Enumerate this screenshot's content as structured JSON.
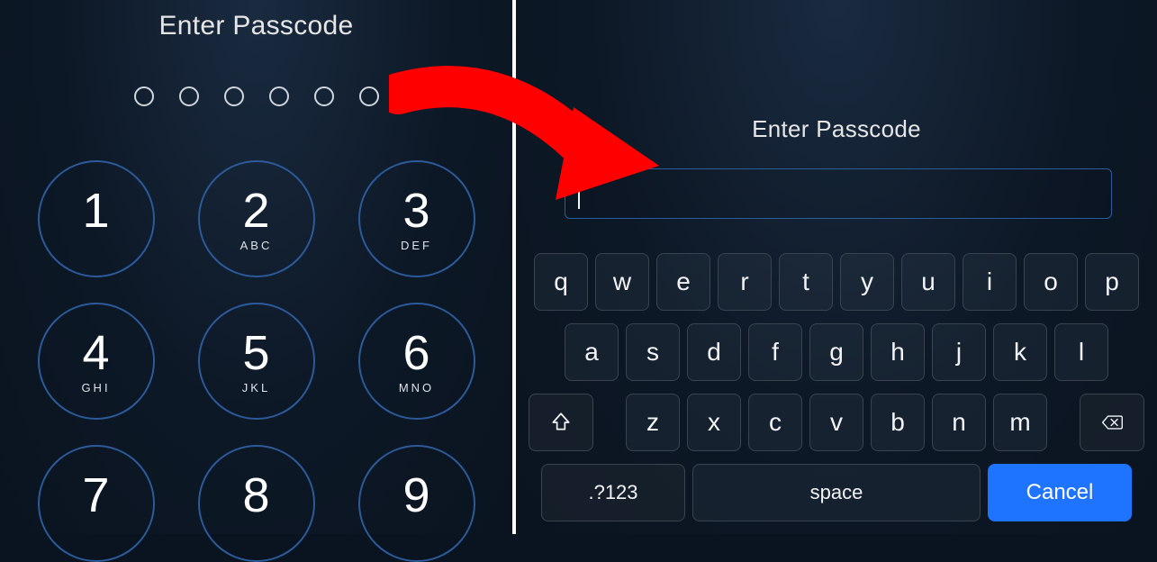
{
  "left": {
    "title": "Enter Passcode",
    "dots_count": 6,
    "keys": [
      {
        "num": "1",
        "sub": ""
      },
      {
        "num": "2",
        "sub": "ABC"
      },
      {
        "num": "3",
        "sub": "DEF"
      },
      {
        "num": "4",
        "sub": "GHI"
      },
      {
        "num": "5",
        "sub": "JKL"
      },
      {
        "num": "6",
        "sub": "MNO"
      },
      {
        "num": "7",
        "sub": ""
      },
      {
        "num": "8",
        "sub": ""
      },
      {
        "num": "9",
        "sub": ""
      }
    ]
  },
  "right": {
    "title": "Enter Passcode",
    "input_value": "",
    "keyboard": {
      "row1": [
        "q",
        "w",
        "e",
        "r",
        "t",
        "y",
        "u",
        "i",
        "o",
        "p"
      ],
      "row2": [
        "a",
        "s",
        "d",
        "f",
        "g",
        "h",
        "j",
        "k",
        "l"
      ],
      "row3": [
        "z",
        "x",
        "c",
        "v",
        "b",
        "n",
        "m"
      ],
      "fn_label": ".?123",
      "space_label": "space",
      "cancel_label": "Cancel"
    }
  }
}
